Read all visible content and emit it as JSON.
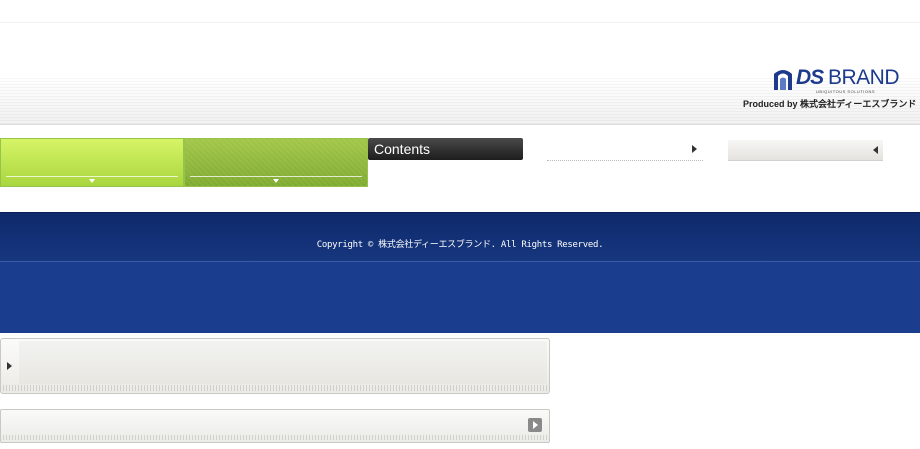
{
  "header": {
    "logo_ds": "DS",
    "logo_brand": "BRAND",
    "logo_tagline": "UBIQUITOUS SOLUTIONS",
    "produced_by": "Produced by 株式会社ディーエスブランド"
  },
  "nav": {
    "contents_label": "Contents"
  },
  "footer": {
    "copyright": "Copyright © 株式会社ディーエスブランド. All Rights Reserved."
  },
  "colors": {
    "accent_green": "#a9d63e",
    "footer_blue": "#1a3d8e",
    "brand_blue": "#1d3a8c"
  }
}
